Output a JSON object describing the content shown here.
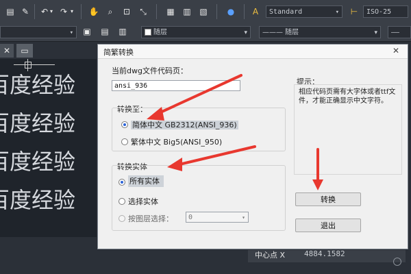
{
  "toolbar": {
    "style_value": "Standard",
    "dim_style_value": "ISO-25",
    "layer_value": "随层",
    "linetype_value": "——— 随层",
    "lineweight_value": "——"
  },
  "doc_tab": {
    "close": "✕"
  },
  "canvas": {
    "lines": [
      "百度经验",
      "百度经验",
      "百度经验",
      "百度经验"
    ]
  },
  "dialog": {
    "title": "简繁转换",
    "current_codepage_label": "当前dwg文件代码页：",
    "current_codepage_value": "ansi_936",
    "convert_to_label": "转换至：",
    "options_convert_to": [
      {
        "label": "简体中文 GB2312(ANSI_936)",
        "selected": true
      },
      {
        "label": "繁体中文 Big5(ANSI_950)",
        "selected": false
      }
    ],
    "entities_label": "转换实体",
    "options_entities": [
      {
        "label": "所有实体",
        "selected": true
      },
      {
        "label": "选择实体",
        "selected": false
      },
      {
        "label": "按图层选择：",
        "selected": false
      }
    ],
    "layer_select_value": "0",
    "hint_label": "提示：",
    "hint_text": "相应代码页需有大字体或者ttf文件，才能正确显示中文字符。",
    "convert_button": "转换",
    "exit_button": "退出"
  },
  "properties": {
    "center_x_label": "中心点 X",
    "center_x_value": "4884.1582"
  },
  "colors": {
    "arrow": "#e8382f",
    "radio_dot": "#2b63d8"
  }
}
